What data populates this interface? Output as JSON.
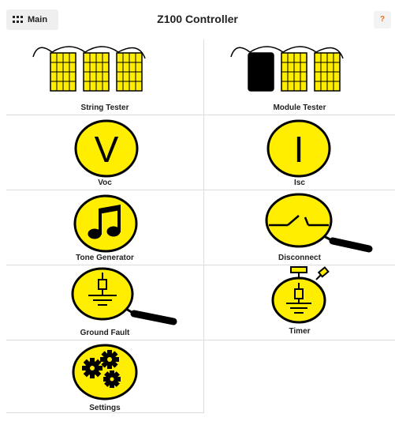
{
  "header": {
    "main_label": "Main",
    "title": "Z100 Controller",
    "help_label": "?"
  },
  "tiles": [
    {
      "label": "String Tester"
    },
    {
      "label": "Module Tester"
    },
    {
      "label": "Voc",
      "symbol": "V"
    },
    {
      "label": "Isc",
      "symbol": "I"
    },
    {
      "label": "Tone Generator"
    },
    {
      "label": "Disconnect"
    },
    {
      "label": "Ground Fault"
    },
    {
      "label": "Timer"
    },
    {
      "label": "Settings"
    }
  ],
  "colors": {
    "icon_fill": "#ffee00",
    "icon_stroke": "#000000",
    "help_text": "#e07020"
  }
}
